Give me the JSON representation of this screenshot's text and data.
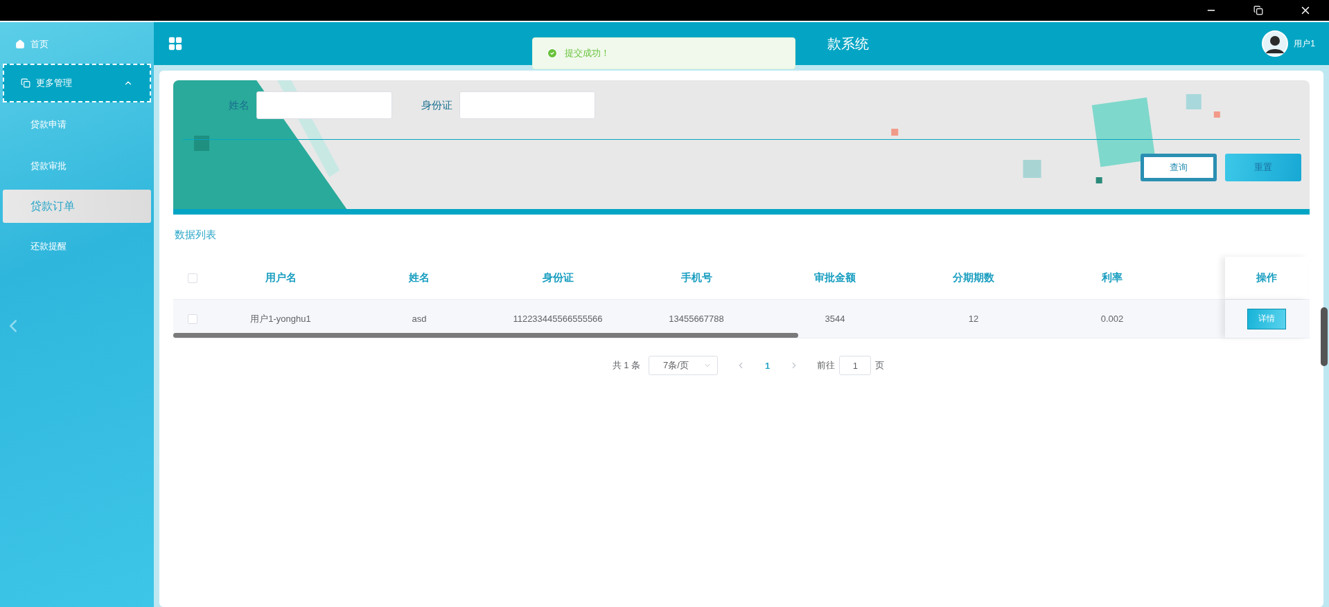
{
  "window_controls": [
    {
      "kind": "minimize"
    },
    {
      "kind": "restore"
    },
    {
      "kind": "close"
    }
  ],
  "sidebar": {
    "items": [
      {
        "label": "首页",
        "kind": "home"
      },
      {
        "label": "更多管理",
        "kind": "group",
        "expanded": true,
        "children": [
          {
            "label": "贷款申请",
            "selected": false
          },
          {
            "label": "贷款审批",
            "selected": false
          },
          {
            "label": "贷款订单",
            "selected": true
          },
          {
            "label": "还款提醒",
            "selected": false
          }
        ]
      }
    ]
  },
  "header": {
    "title": "款系统",
    "user": "用户1"
  },
  "toast": {
    "kind": "success",
    "message": "提交成功！"
  },
  "search": {
    "fields": [
      {
        "label": "姓名"
      },
      {
        "label": "身份证"
      }
    ],
    "buttons": [
      {
        "label": "查询",
        "kind": "outline"
      },
      {
        "label": "重置",
        "kind": "filled"
      }
    ]
  },
  "section_title": "数据列表",
  "table": {
    "select_all_checked": false,
    "columns": [
      "用户名",
      "姓名",
      "身份证",
      "手机号",
      "审批金额",
      "分期期数",
      "利率",
      "操作"
    ],
    "rows": [
      {
        "checked": false,
        "cells": [
          "用户1-yonghu1",
          "asd",
          "112233445566555566",
          "13455667788",
          "3544",
          "12",
          "0.002"
        ],
        "action": "详情"
      }
    ]
  },
  "pagination": {
    "total": "共 1 条",
    "page_size": "7条/页",
    "pages": [
      {
        "label": "1",
        "selected": true
      }
    ],
    "goto_label": "前往",
    "goto_value": "1",
    "goto_suffix": "页"
  }
}
